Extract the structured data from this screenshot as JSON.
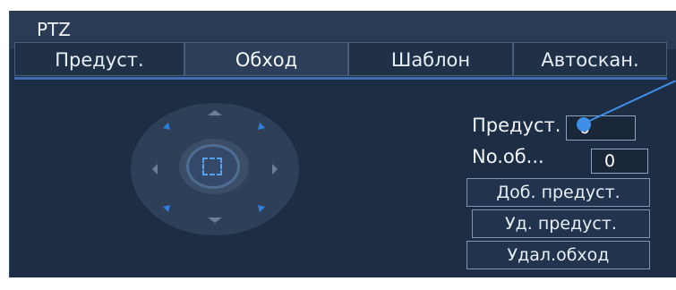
{
  "window": {
    "title": "PTZ"
  },
  "tabs": [
    {
      "label": "Предуст."
    },
    {
      "label": "Обход"
    },
    {
      "label": "Шаблон"
    },
    {
      "label": "Автоскан."
    }
  ],
  "form": {
    "preset": {
      "label": "Предуст.",
      "value": "0"
    },
    "tour_no": {
      "label": "No.об...",
      "value": "0"
    }
  },
  "buttons": {
    "add_preset": "Доб. предуст.",
    "delete_preset": "Уд. предуст.",
    "delete_tour": "Удал.обход"
  },
  "colors": {
    "accent": "#3f8fe8",
    "background": "#1d2d44",
    "titlebar": "#2a3b55"
  }
}
